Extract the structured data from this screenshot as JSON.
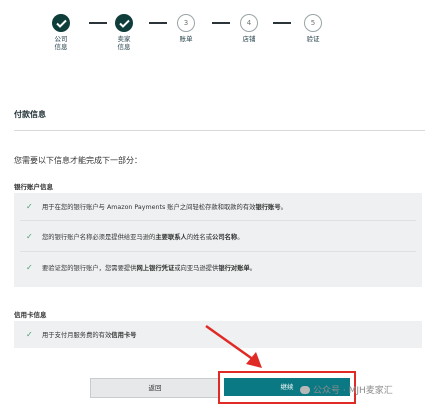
{
  "stepper": {
    "steps": [
      {
        "label": "公司\n信息",
        "state": "done"
      },
      {
        "label": "卖家\n信息",
        "state": "done"
      },
      {
        "number": "3",
        "label": "账单",
        "state": "pending"
      },
      {
        "number": "4",
        "label": "店铺",
        "state": "pending"
      },
      {
        "number": "5",
        "label": "验证",
        "state": "pending"
      }
    ]
  },
  "page": {
    "section_title": "付款信息",
    "intro": "您需要以下信息才能完成下一部分："
  },
  "bank": {
    "title": "银行账户信息",
    "items": [
      {
        "pre": "用于在您的银行账户与 Amazon Payments 账户之间轻松存款和取款的有效",
        "bold": "银行账号",
        "post": "。"
      },
      {
        "pre": "您的银行账户名称必须是提供给亚马逊的",
        "bold": "主要联系人",
        "mid": "的姓名或",
        "bold2": "公司名称",
        "post": "。"
      },
      {
        "pre": "要验证您的银行账户，您需要提供",
        "bold": "网上银行凭证",
        "mid": "或向亚马逊提供",
        "bold2": "银行对账单",
        "post": "。"
      }
    ]
  },
  "card": {
    "title": "信用卡信息",
    "items": [
      {
        "pre": "用于支付月服务费的有效",
        "bold": "信用卡号",
        "post": ""
      }
    ]
  },
  "buttons": {
    "back": "返回",
    "continue": "继续"
  },
  "watermark": "公众号 · MJH麦家汇",
  "colors": {
    "primary": "#0b7983",
    "step_done": "#0f3d3a",
    "check": "#4a9d77",
    "annotation": "#e02a25"
  }
}
